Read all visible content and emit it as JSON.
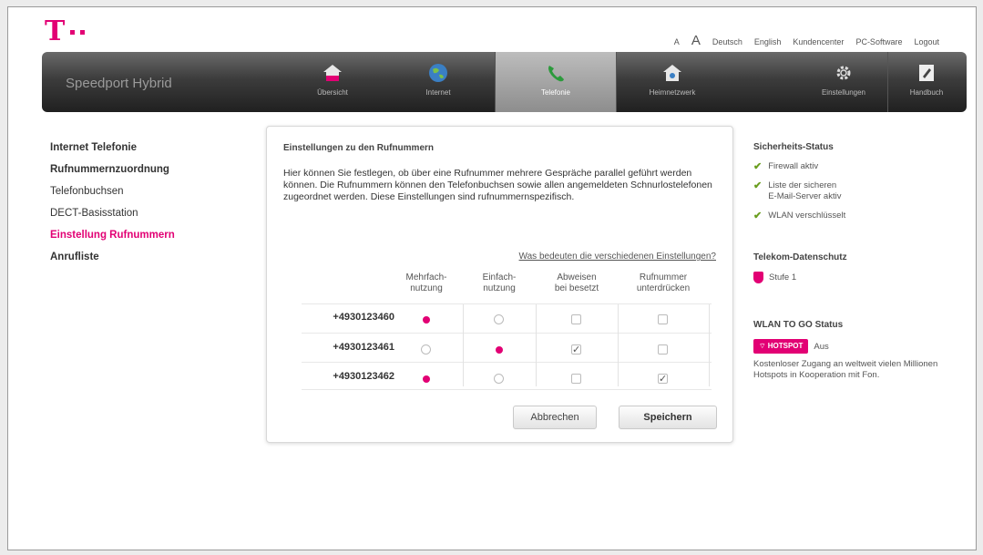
{
  "header": {
    "logo_letter": "T",
    "font_small": "A",
    "font_large": "A",
    "links": [
      "Deutsch",
      "English",
      "Kundencenter",
      "PC-Software",
      "Logout"
    ]
  },
  "nav": {
    "brand": "Speedport Hybrid",
    "items": [
      {
        "label": "Übersicht",
        "icon": "house-icon"
      },
      {
        "label": "Internet",
        "icon": "globe-icon"
      },
      {
        "label": "Telefonie",
        "icon": "phone-icon",
        "active": true
      },
      {
        "label": "Heimnetzwerk",
        "icon": "home-network-icon"
      },
      {
        "label": "Einstellungen",
        "icon": "gear-icon"
      },
      {
        "label": "Handbuch",
        "icon": "manual-icon"
      }
    ]
  },
  "sidebar": {
    "items": [
      "Internet Telefonie",
      "Rufnummernzuordnung",
      "Telefonbuchsen",
      "DECT-Basisstation",
      "Einstellung Rufnummern",
      "Anrufliste"
    ]
  },
  "panel": {
    "title": "Einstellungen zu den Rufnummern",
    "text": "Hier können Sie festlegen, ob über eine Rufnummer mehrere Gespräche parallel geführt werden können. Die Rufnummern können den Telefonbuchsen sowie allen angemeldeten Schnurlostelefonen zugeordnet werden. Diese Einstellungen sind rufnummernspezifisch.",
    "link": "Was bedeuten die verschiedenen Einstellungen?",
    "columns": [
      {
        "l1": "Mehrfach-",
        "l2": "nutzung"
      },
      {
        "l1": "Einfach-",
        "l2": "nutzung"
      },
      {
        "l1": "Abweisen",
        "l2": "bei besetzt"
      },
      {
        "l1": "Rufnummer",
        "l2": "unterdrücken"
      }
    ],
    "rows": [
      {
        "number": "+4930123460",
        "mehrfach": true,
        "einfach": false,
        "abweisen": false,
        "unterdruecken": false
      },
      {
        "number": "+4930123461",
        "mehrfach": false,
        "einfach": true,
        "abweisen": true,
        "unterdruecken": false
      },
      {
        "number": "+4930123462",
        "mehrfach": true,
        "einfach": false,
        "abweisen": false,
        "unterdruecken": true
      }
    ],
    "cancel": "Abbrechen",
    "save": "Speichern"
  },
  "right": {
    "security_title": "Sicherheits-Status",
    "security_items": [
      {
        "l1": "Firewall aktiv",
        "l2": ""
      },
      {
        "l1": "Liste der sicheren",
        "l2": "E-Mail-Server aktiv"
      },
      {
        "l1": "WLAN verschlüsselt",
        "l2": ""
      }
    ],
    "privacy_title": "Telekom-Datenschutz",
    "privacy_level": "Stufe 1",
    "wlan_title": "WLAN TO GO Status",
    "hotspot_badge": "HOTSPOT",
    "hotspot_state": "Aus",
    "hotspot_desc": "Kostenloser Zugang an weltweit vielen Millionen Hotspots in Kooperation mit Fon."
  },
  "colors": {
    "magenta": "#e20074",
    "check_green": "#6a9e1f"
  }
}
